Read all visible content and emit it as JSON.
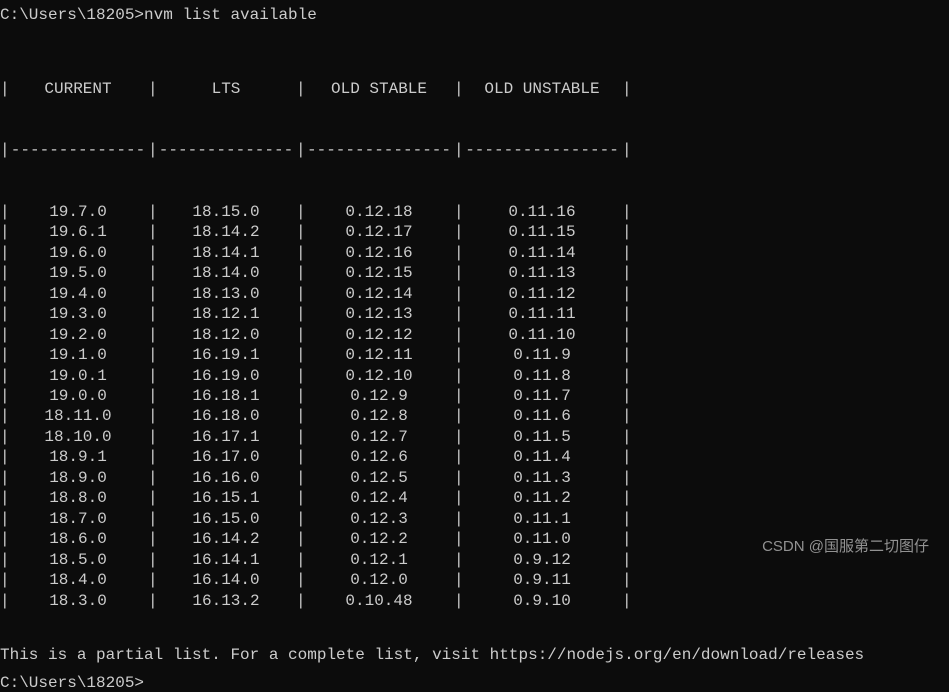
{
  "prompt": {
    "path": "C:\\Users\\18205>",
    "command": "nvm list available"
  },
  "table": {
    "headers": [
      "CURRENT",
      "LTS",
      "OLD STABLE",
      "OLD UNSTABLE"
    ],
    "separator": "|",
    "rows": [
      [
        "19.7.0",
        "18.15.0",
        "0.12.18",
        "0.11.16"
      ],
      [
        "19.6.1",
        "18.14.2",
        "0.12.17",
        "0.11.15"
      ],
      [
        "19.6.0",
        "18.14.1",
        "0.12.16",
        "0.11.14"
      ],
      [
        "19.5.0",
        "18.14.0",
        "0.12.15",
        "0.11.13"
      ],
      [
        "19.4.0",
        "18.13.0",
        "0.12.14",
        "0.11.12"
      ],
      [
        "19.3.0",
        "18.12.1",
        "0.12.13",
        "0.11.11"
      ],
      [
        "19.2.0",
        "18.12.0",
        "0.12.12",
        "0.11.10"
      ],
      [
        "19.1.0",
        "16.19.1",
        "0.12.11",
        "0.11.9"
      ],
      [
        "19.0.1",
        "16.19.0",
        "0.12.10",
        "0.11.8"
      ],
      [
        "19.0.0",
        "16.18.1",
        "0.12.9",
        "0.11.7"
      ],
      [
        "18.11.0",
        "16.18.0",
        "0.12.8",
        "0.11.6"
      ],
      [
        "18.10.0",
        "16.17.1",
        "0.12.7",
        "0.11.5"
      ],
      [
        "18.9.1",
        "16.17.0",
        "0.12.6",
        "0.11.4"
      ],
      [
        "18.9.0",
        "16.16.0",
        "0.12.5",
        "0.11.3"
      ],
      [
        "18.8.0",
        "16.15.1",
        "0.12.4",
        "0.11.2"
      ],
      [
        "18.7.0",
        "16.15.0",
        "0.12.3",
        "0.11.1"
      ],
      [
        "18.6.0",
        "16.14.2",
        "0.12.2",
        "0.11.0"
      ],
      [
        "18.5.0",
        "16.14.1",
        "0.12.1",
        "0.9.12"
      ],
      [
        "18.4.0",
        "16.14.0",
        "0.12.0",
        "0.9.11"
      ],
      [
        "18.3.0",
        "16.13.2",
        "0.10.48",
        "0.9.10"
      ]
    ]
  },
  "footer": "This is a partial list. For a complete list, visit https://nodejs.org/en/download/releases",
  "prompt2": "C:\\Users\\18205>",
  "watermark": "CSDN @国服第二切图仔"
}
